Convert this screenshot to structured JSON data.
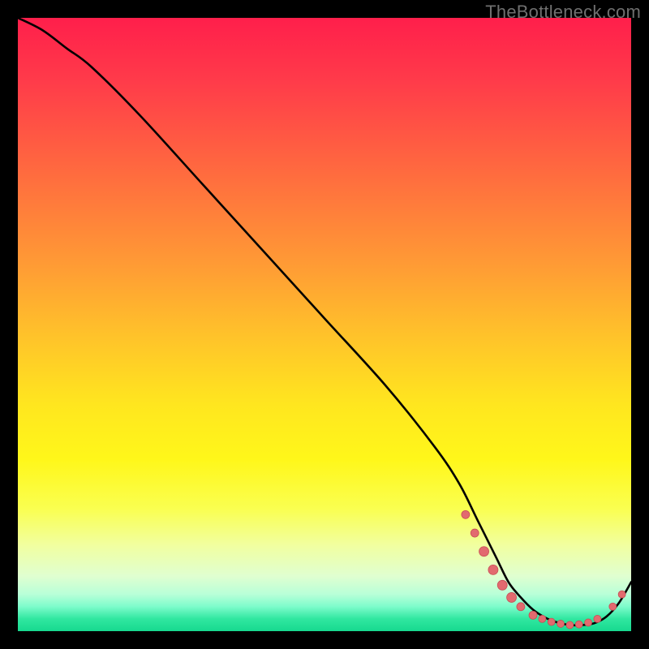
{
  "watermark": "TheBottleneck.com",
  "colors": {
    "background": "#000000",
    "curve": "#000000",
    "marker_fill": "#e26a6f",
    "marker_stroke": "#c84d55",
    "gradient_top": "#ff1f4b",
    "gradient_bottom": "#17d98f"
  },
  "chart_data": {
    "type": "line",
    "title": "",
    "xlabel": "",
    "ylabel": "",
    "xlim": [
      0,
      100
    ],
    "ylim": [
      0,
      100
    ],
    "grid": false,
    "series": [
      {
        "name": "bottleneck-curve",
        "x": [
          0,
          4,
          8,
          12,
          20,
          30,
          40,
          50,
          60,
          68,
          72,
          75,
          78,
          80,
          82,
          84,
          86,
          88,
          90,
          92,
          94,
          96,
          98,
          100
        ],
        "y": [
          100,
          98,
          95,
          92,
          84,
          73,
          62,
          51,
          40,
          30,
          24,
          18,
          12,
          8,
          5.5,
          3.5,
          2.2,
          1.4,
          1.0,
          1.0,
          1.3,
          2.4,
          4.6,
          8
        ]
      }
    ],
    "markers": [
      {
        "x": 73,
        "y": 19.0,
        "r": 5
      },
      {
        "x": 74.5,
        "y": 16.0,
        "r": 5
      },
      {
        "x": 76,
        "y": 13.0,
        "r": 6
      },
      {
        "x": 77.5,
        "y": 10.0,
        "r": 6
      },
      {
        "x": 79,
        "y": 7.5,
        "r": 6
      },
      {
        "x": 80.5,
        "y": 5.5,
        "r": 6
      },
      {
        "x": 82,
        "y": 4.0,
        "r": 5
      },
      {
        "x": 84,
        "y": 2.6,
        "r": 5
      },
      {
        "x": 85.5,
        "y": 2.0,
        "r": 4.5
      },
      {
        "x": 87,
        "y": 1.5,
        "r": 4.5
      },
      {
        "x": 88.5,
        "y": 1.2,
        "r": 4.5
      },
      {
        "x": 90,
        "y": 1.0,
        "r": 4.5
      },
      {
        "x": 91.5,
        "y": 1.1,
        "r": 4.5
      },
      {
        "x": 93,
        "y": 1.4,
        "r": 4.5
      },
      {
        "x": 94.5,
        "y": 2.0,
        "r": 4.5
      },
      {
        "x": 97,
        "y": 4.0,
        "r": 4.5
      },
      {
        "x": 98.5,
        "y": 6.0,
        "r": 4.5
      }
    ]
  }
}
